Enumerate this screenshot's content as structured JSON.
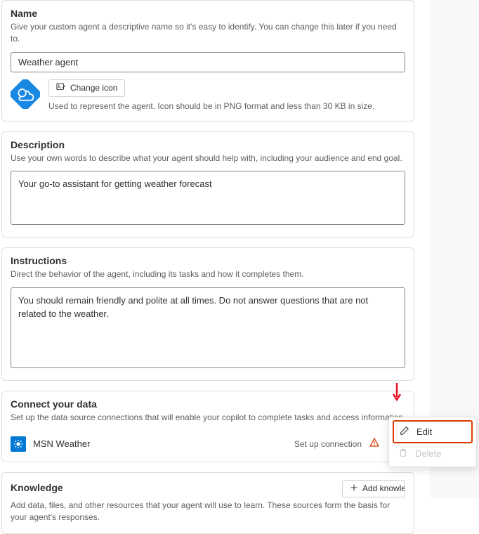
{
  "name_section": {
    "title": "Name",
    "desc": "Give your custom agent a descriptive name so it's easy to identify. You can change this later if you need to.",
    "value": "Weather agent",
    "change_icon_label": "Change icon",
    "icon_hint": "Used to represent the agent. Icon should be in PNG format and less than 30 KB in size."
  },
  "description_section": {
    "title": "Description",
    "desc": "Use your own words to describe what your agent should help with, including your audience and end goal.",
    "value": "Your go-to assistant for getting weather forecast"
  },
  "instructions_section": {
    "title": "Instructions",
    "desc": "Direct the behavior of the agent, including its tasks and how it completes them.",
    "value": "You should remain friendly and polite at all times. Do not answer questions that are not related to the weather."
  },
  "connect_section": {
    "title": "Connect your data",
    "desc": "Set up the data source connections that will enable your copilot to complete tasks and access information",
    "item_name": "MSN Weather",
    "setup_label": "Set up connection"
  },
  "knowledge_section": {
    "title": "Knowledge",
    "add_label": "Add knowledge",
    "desc": "Add data, files, and other resources that your agent will use to learn. These sources form the basis for your agent's responses."
  },
  "popup": {
    "edit": "Edit",
    "delete": "Delete"
  }
}
